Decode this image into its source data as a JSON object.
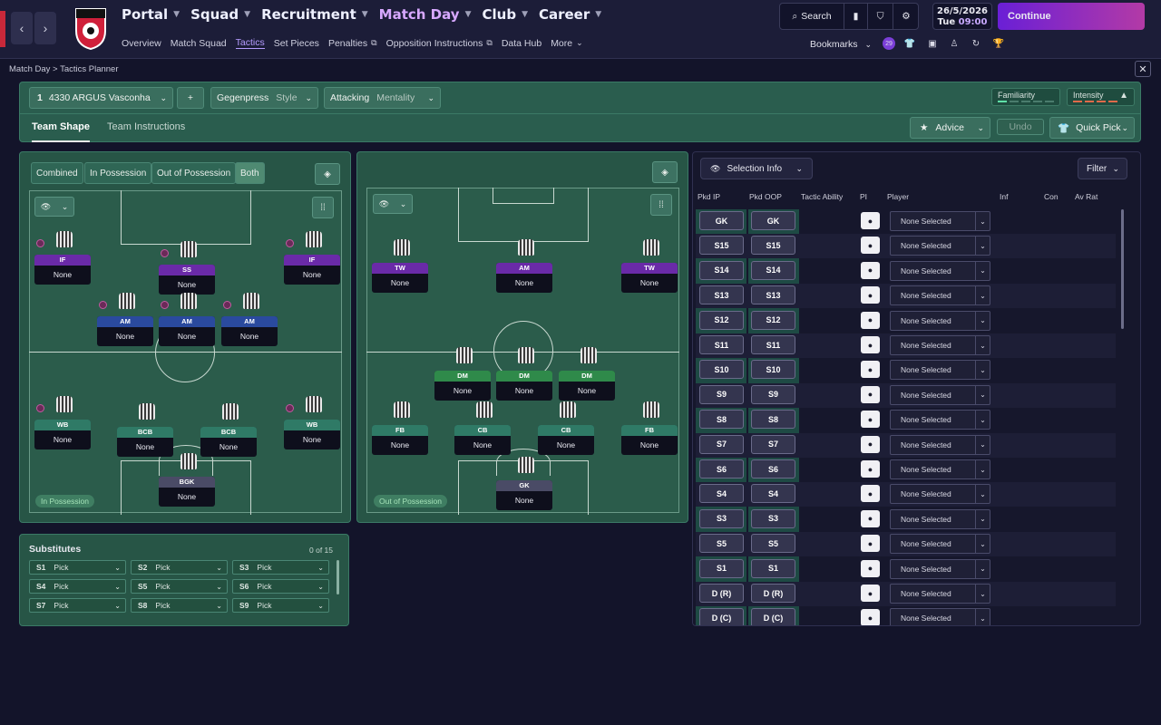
{
  "nav": {
    "back_glyph": "‹",
    "forward_glyph": "›",
    "main_items": [
      {
        "label": "Portal"
      },
      {
        "label": "Squad"
      },
      {
        "label": "Recruitment"
      },
      {
        "label": "Match Day",
        "active": true
      },
      {
        "label": "Club"
      },
      {
        "label": "Career"
      }
    ],
    "sub_items": [
      {
        "label": "Overview"
      },
      {
        "label": "Match Squad"
      },
      {
        "label": "Tactics",
        "active": true
      },
      {
        "label": "Set Pieces"
      },
      {
        "label": "Penalties",
        "external": true
      },
      {
        "label": "Opposition Instructions",
        "external": true
      },
      {
        "label": "Data Hub"
      },
      {
        "label": "More"
      }
    ],
    "search_label": "Search",
    "date": "26/5/2026",
    "day": "Tue",
    "time": "09:00",
    "continue_label": "Continue",
    "bookmarks_label": "Bookmarks",
    "notification_count": "29",
    "club_crest_icon": "afc-bournemouth-crest",
    "accent_color": "#b59cff"
  },
  "breadcrumb": {
    "parent": "Match Day",
    "separator": ">",
    "current": "Tactics Planner"
  },
  "tactic": {
    "slot_number": "1",
    "name": "4330 ARGUS Vasconha",
    "add_label": "+",
    "style_value": "Gegenpress",
    "style_label": "Style",
    "mentality_value": "Attacking",
    "mentality_label": "Mentality",
    "familiarity_label": "Familiarity",
    "intensity_label": "Intensity",
    "tabs": [
      "Team Shape",
      "Team Instructions"
    ],
    "advice_label": "Advice",
    "undo_label": "Undo",
    "quick_pick_label": "Quick Pick"
  },
  "modes": [
    "Combined",
    "In Possession",
    "Out of Possession",
    "Both"
  ],
  "in_possession": {
    "badge": "In Possession",
    "players": [
      {
        "role": "IF",
        "name": "None",
        "color": "#6a2aa8"
      },
      {
        "role": "SS",
        "name": "None",
        "color": "#6a2aa8"
      },
      {
        "role": "IF",
        "name": "None",
        "color": "#6a2aa8"
      },
      {
        "role": "AM",
        "name": "None",
        "color": "#2a4a9e"
      },
      {
        "role": "AM",
        "name": "None",
        "color": "#2a4a9e"
      },
      {
        "role": "AM",
        "name": "None",
        "color": "#2a4a9e"
      },
      {
        "role": "WB",
        "name": "None",
        "color": "#2f7a66"
      },
      {
        "role": "BCB",
        "name": "None",
        "color": "#2f7a66"
      },
      {
        "role": "BCB",
        "name": "None",
        "color": "#2f7a66"
      },
      {
        "role": "WB",
        "name": "None",
        "color": "#2f7a66"
      },
      {
        "role": "BGK",
        "name": "None",
        "color": "#4a4b66"
      }
    ]
  },
  "out_of_possession": {
    "badge": "Out of Possession",
    "players": [
      {
        "role": "TW",
        "name": "None",
        "color": "#6a2aa8"
      },
      {
        "role": "AM",
        "name": "None",
        "color": "#6a2aa8"
      },
      {
        "role": "TW",
        "name": "None",
        "color": "#6a2aa8"
      },
      {
        "role": "DM",
        "name": "None",
        "color": "#2f8a4a"
      },
      {
        "role": "DM",
        "name": "None",
        "color": "#2f8a4a"
      },
      {
        "role": "DM",
        "name": "None",
        "color": "#2f8a4a"
      },
      {
        "role": "FB",
        "name": "None",
        "color": "#2f7a66"
      },
      {
        "role": "CB",
        "name": "None",
        "color": "#2f7a66"
      },
      {
        "role": "CB",
        "name": "None",
        "color": "#2f7a66"
      },
      {
        "role": "FB",
        "name": "None",
        "color": "#2f7a66"
      },
      {
        "role": "GK",
        "name": "None",
        "color": "#4a4b66"
      }
    ]
  },
  "substitutes": {
    "title": "Substitutes",
    "count": "0 of 15",
    "slots": [
      {
        "code": "S1",
        "value": "Pick"
      },
      {
        "code": "S2",
        "value": "Pick"
      },
      {
        "code": "S3",
        "value": "Pick"
      },
      {
        "code": "S4",
        "value": "Pick"
      },
      {
        "code": "S5",
        "value": "Pick"
      },
      {
        "code": "S6",
        "value": "Pick"
      },
      {
        "code": "S7",
        "value": "Pick"
      },
      {
        "code": "S8",
        "value": "Pick"
      },
      {
        "code": "S9",
        "value": "Pick"
      }
    ]
  },
  "selection": {
    "view_label": "Selection Info",
    "filter_label": "Filter",
    "columns": [
      "Pkd IP",
      "Pkd OOP",
      "Tactic Ability",
      "PI",
      "Player",
      "Inf",
      "Con",
      "Av Rat"
    ],
    "rows": [
      {
        "ip": "GK",
        "oop": "GK",
        "player": "None Selected"
      },
      {
        "ip": "S15",
        "oop": "S15",
        "player": "None Selected"
      },
      {
        "ip": "S14",
        "oop": "S14",
        "player": "None Selected"
      },
      {
        "ip": "S13",
        "oop": "S13",
        "player": "None Selected"
      },
      {
        "ip": "S12",
        "oop": "S12",
        "player": "None Selected"
      },
      {
        "ip": "S11",
        "oop": "S11",
        "player": "None Selected"
      },
      {
        "ip": "S10",
        "oop": "S10",
        "player": "None Selected"
      },
      {
        "ip": "S9",
        "oop": "S9",
        "player": "None Selected"
      },
      {
        "ip": "S8",
        "oop": "S8",
        "player": "None Selected"
      },
      {
        "ip": "S7",
        "oop": "S7",
        "player": "None Selected"
      },
      {
        "ip": "S6",
        "oop": "S6",
        "player": "None Selected"
      },
      {
        "ip": "S4",
        "oop": "S4",
        "player": "None Selected"
      },
      {
        "ip": "S3",
        "oop": "S3",
        "player": "None Selected"
      },
      {
        "ip": "S5",
        "oop": "S5",
        "player": "None Selected"
      },
      {
        "ip": "S1",
        "oop": "S1",
        "player": "None Selected"
      },
      {
        "ip": "D (R)",
        "oop": "D (R)",
        "player": "None Selected"
      },
      {
        "ip": "D (C)",
        "oop": "D (C)",
        "player": "None Selected"
      }
    ]
  }
}
